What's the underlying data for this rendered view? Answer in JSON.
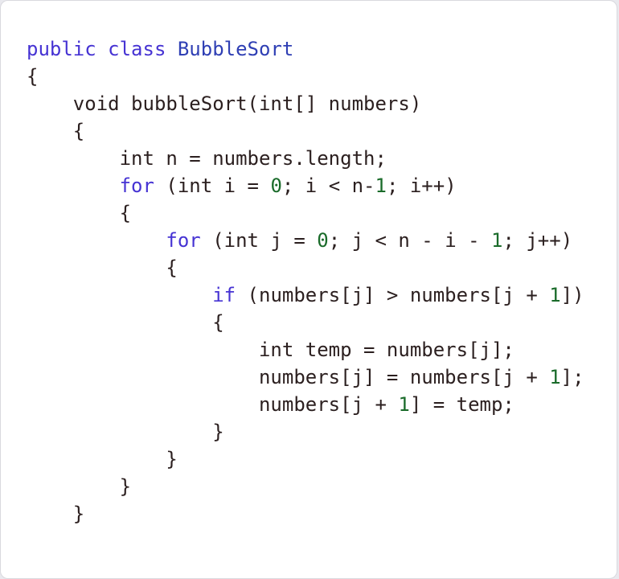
{
  "colors": {
    "keyword": "#4633d3",
    "type_name": "#2f3fb4",
    "number": "#1a6b2a",
    "text": "#2b1f1f",
    "background": "#ffffff"
  },
  "code": {
    "language": "java",
    "lines": [
      [
        {
          "t": "public class ",
          "k": "kw"
        },
        {
          "t": "BubbleSort",
          "k": "type"
        }
      ],
      [
        {
          "t": "{",
          "k": "plain"
        }
      ],
      [
        {
          "t": "    void bubbleSort(int[] numbers)",
          "k": "plain"
        }
      ],
      [
        {
          "t": "    {",
          "k": "plain"
        }
      ],
      [
        {
          "t": "        int n = numbers.length;",
          "k": "plain"
        }
      ],
      [
        {
          "t": "        ",
          "k": "plain"
        },
        {
          "t": "for",
          "k": "kw"
        },
        {
          "t": " (int i = ",
          "k": "plain"
        },
        {
          "t": "0",
          "k": "num"
        },
        {
          "t": "; i < n-",
          "k": "plain"
        },
        {
          "t": "1",
          "k": "num"
        },
        {
          "t": "; i++)",
          "k": "plain"
        }
      ],
      [
        {
          "t": "        {",
          "k": "plain"
        }
      ],
      [
        {
          "t": "            ",
          "k": "plain"
        },
        {
          "t": "for",
          "k": "kw"
        },
        {
          "t": " (int j = ",
          "k": "plain"
        },
        {
          "t": "0",
          "k": "num"
        },
        {
          "t": "; j < n - i - ",
          "k": "plain"
        },
        {
          "t": "1",
          "k": "num"
        },
        {
          "t": "; j++)",
          "k": "plain"
        }
      ],
      [
        {
          "t": "            {",
          "k": "plain"
        }
      ],
      [
        {
          "t": "                ",
          "k": "plain"
        },
        {
          "t": "if",
          "k": "kw"
        },
        {
          "t": " (numbers[j] > numbers[j + ",
          "k": "plain"
        },
        {
          "t": "1",
          "k": "num"
        },
        {
          "t": "])",
          "k": "plain"
        }
      ],
      [
        {
          "t": "                {",
          "k": "plain"
        }
      ],
      [
        {
          "t": "                    int temp = numbers[j];",
          "k": "plain"
        }
      ],
      [
        {
          "t": "                    numbers[j] = numbers[j + ",
          "k": "plain"
        },
        {
          "t": "1",
          "k": "num"
        },
        {
          "t": "];",
          "k": "plain"
        }
      ],
      [
        {
          "t": "                    numbers[j + ",
          "k": "plain"
        },
        {
          "t": "1",
          "k": "num"
        },
        {
          "t": "] = temp;",
          "k": "plain"
        }
      ],
      [
        {
          "t": "                }",
          "k": "plain"
        }
      ],
      [
        {
          "t": "            }",
          "k": "plain"
        }
      ],
      [
        {
          "t": "        }",
          "k": "plain"
        }
      ],
      [
        {
          "t": "    }",
          "k": "plain"
        }
      ]
    ]
  }
}
